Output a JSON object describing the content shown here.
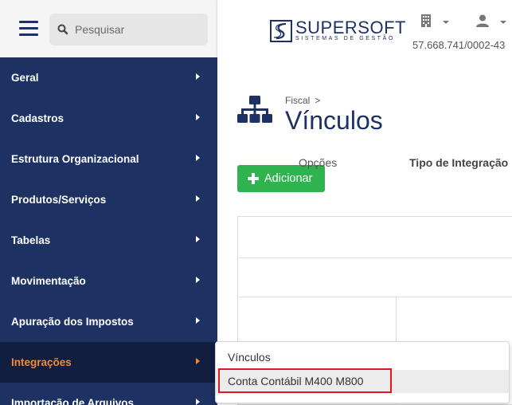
{
  "search": {
    "placeholder": "Pesquisar"
  },
  "sidebar": {
    "items": [
      {
        "label": "Geral"
      },
      {
        "label": "Cadastros"
      },
      {
        "label": "Estrutura Organizacional"
      },
      {
        "label": "Produtos/Serviços"
      },
      {
        "label": "Tabelas"
      },
      {
        "label": "Movimentação"
      },
      {
        "label": "Apuração dos Impostos"
      },
      {
        "label": "Integrações",
        "active": true
      },
      {
        "label": "Importação de Arquivos"
      }
    ]
  },
  "header": {
    "brand": "SUPERSOFT",
    "brand_sub": "SISTEMAS DE GESTÃO",
    "cnpj": "57.668.741/0002-43"
  },
  "page": {
    "breadcrumb": "Fiscal",
    "breadcrumb_sep": ">",
    "title": "Vínculos",
    "add_label": "Adicionar"
  },
  "grid": {
    "columns": [
      "Opções",
      "Tipo de Integração"
    ]
  },
  "dropdown": {
    "items": [
      "Vínculos",
      "Conta Contábil M400 M800"
    ]
  },
  "colors": {
    "sidebar_bg": "#1e3163",
    "active_bg": "#121e40",
    "active_text": "#f28a2e",
    "add_button": "#2eb34e",
    "highlight": "#e0171d"
  }
}
